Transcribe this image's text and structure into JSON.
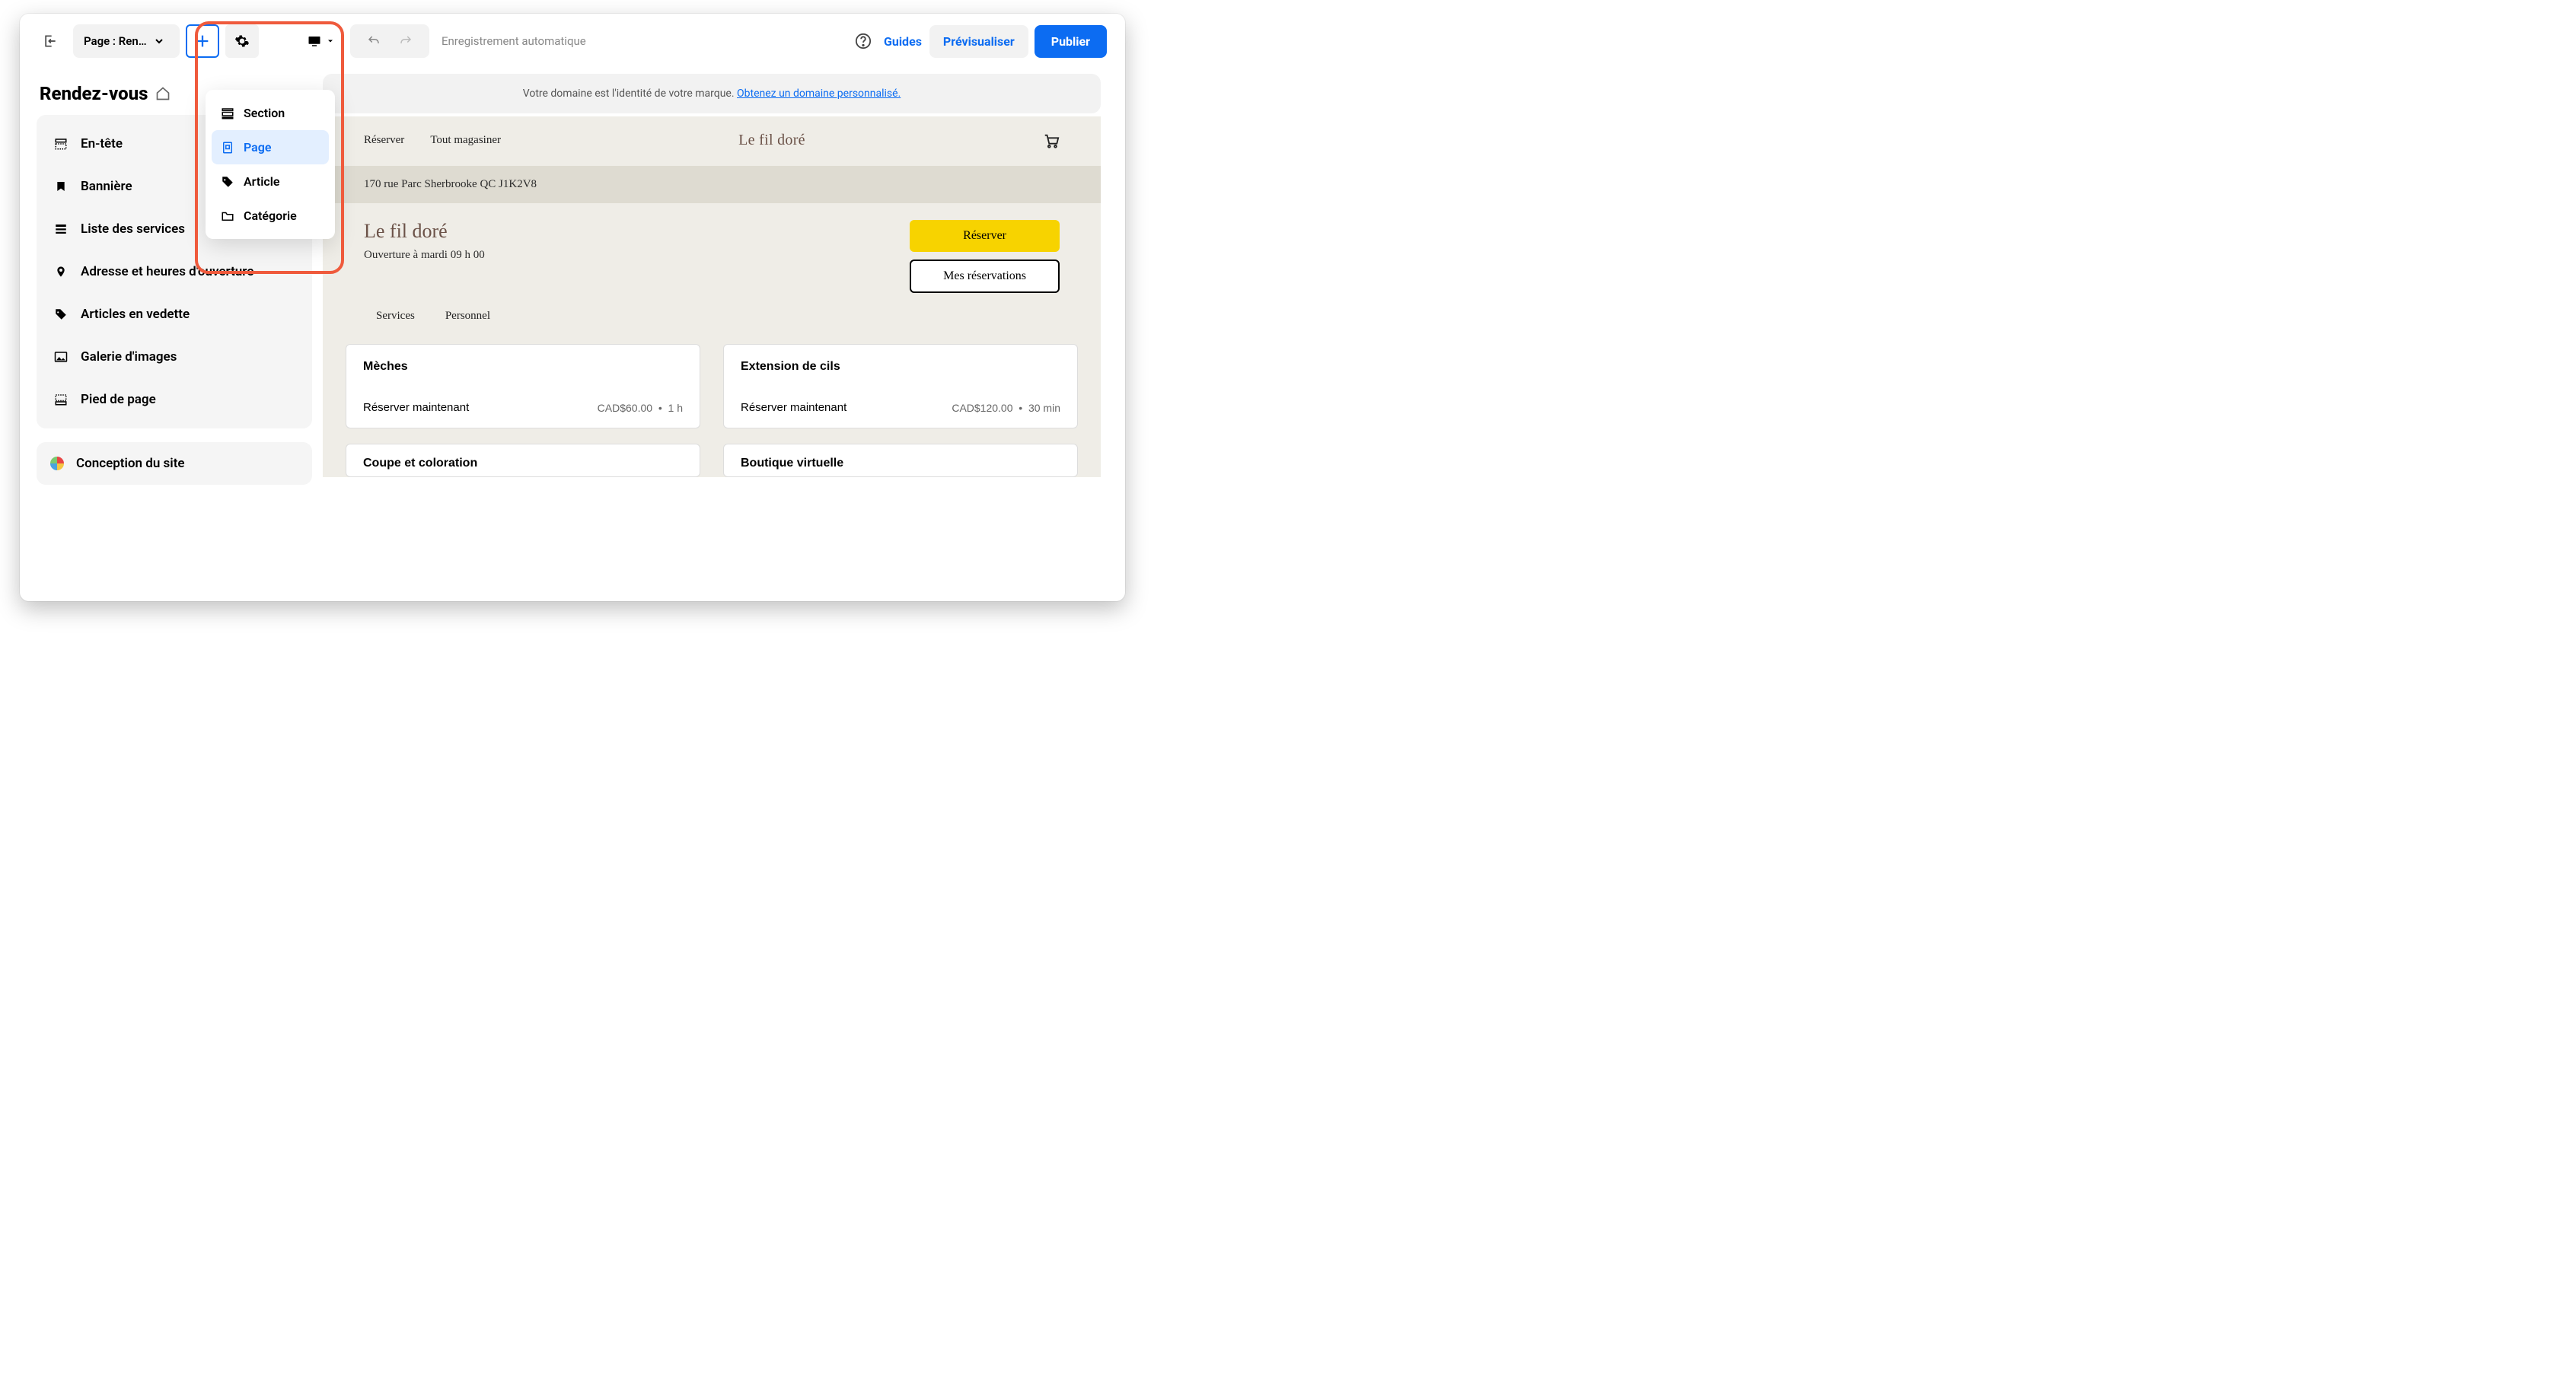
{
  "topbar": {
    "page_selector": "Page : Ren…",
    "autosave": "Enregistrement automatique",
    "guides": "Guides",
    "preview": "Prévisualiser",
    "publish": "Publier"
  },
  "add_menu": {
    "section": "Section",
    "page": "Page",
    "article": "Article",
    "category": "Catégorie"
  },
  "sidebar": {
    "title": "Rendez-vous",
    "items": [
      {
        "label": "En-tête",
        "icon": "header-icon"
      },
      {
        "label": "Bannière",
        "icon": "bookmark-icon"
      },
      {
        "label": "Liste des services",
        "icon": "list-icon"
      },
      {
        "label": "Adresse et heures d'ouverture",
        "icon": "pin-icon"
      },
      {
        "label": "Articles en vedette",
        "icon": "tag-icon"
      },
      {
        "label": "Galerie d'images",
        "icon": "image-icon"
      },
      {
        "label": "Pied de page",
        "icon": "footer-icon"
      }
    ],
    "design": "Conception du site"
  },
  "domain_banner": {
    "text": "Votre domaine est l'identité de votre marque. ",
    "link": "Obtenez un domaine personnalisé."
  },
  "site": {
    "nav": {
      "reserve": "Réserver",
      "shop_all": "Tout magasiner"
    },
    "brand": "Le fil doré",
    "address": "170 rue Parc Sherbrooke QC J1K2V8",
    "title": "Le fil doré",
    "subtitle": "Ouverture à mardi 09 h 00",
    "primary_btn": "Réserver",
    "secondary_btn": "Mes réservations",
    "tabs": {
      "services": "Services",
      "staff": "Personnel"
    },
    "cards": [
      {
        "title": "Mèches",
        "action": "Réserver maintenant",
        "price": "CAD$60.00",
        "dur": "1 h"
      },
      {
        "title": "Extension de cils",
        "action": "Réserver maintenant",
        "price": "CAD$120.00",
        "dur": "30 min"
      }
    ],
    "cards2": [
      {
        "title": "Coupe et coloration"
      },
      {
        "title": "Boutique virtuelle"
      }
    ]
  }
}
